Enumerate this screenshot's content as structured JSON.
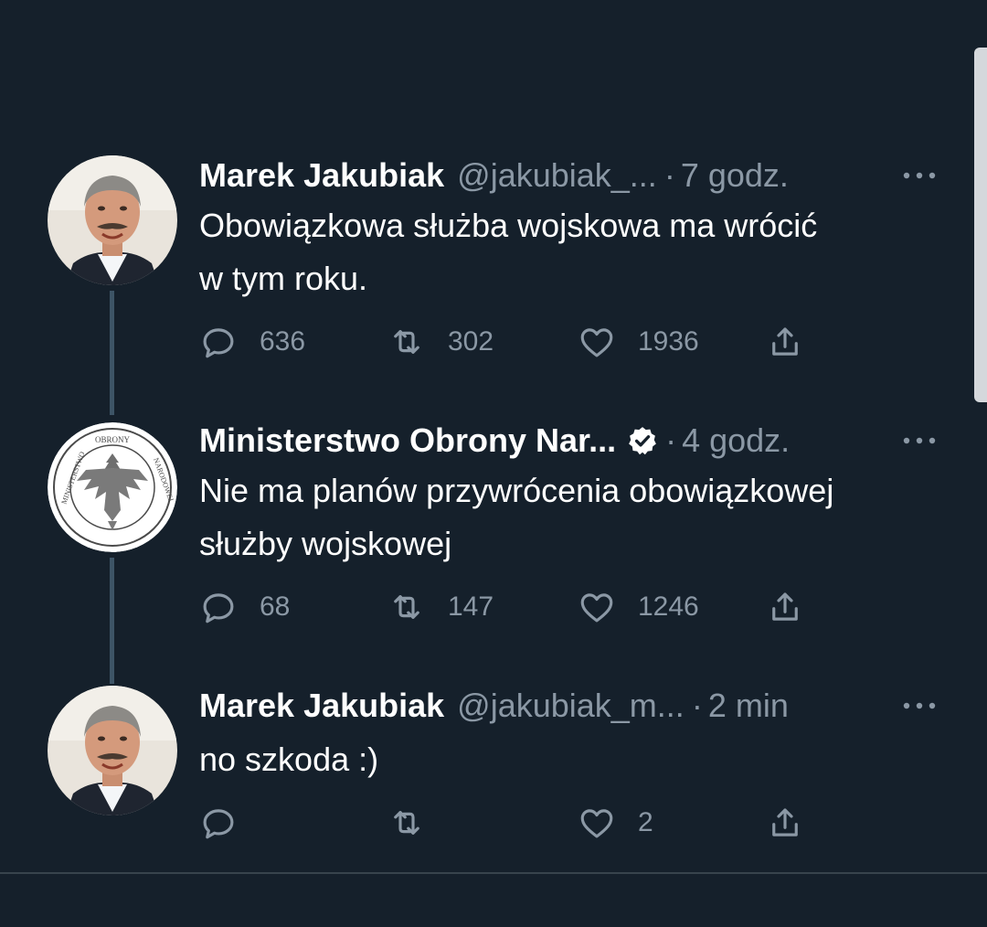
{
  "tweets": [
    {
      "name": "Marek Jakubiak",
      "handle": "@jakubiak_...",
      "separator": "·",
      "time": "7 godz.",
      "verified": false,
      "text_lines": [
        "Obowiązkowa służba wojskowa ma wrócić",
        "w tym roku."
      ],
      "replies": "636",
      "retweets": "302",
      "likes": "1936"
    },
    {
      "name": "Ministerstwo Obrony Nar...",
      "handle": "",
      "separator": "·",
      "time": "4 godz.",
      "verified": true,
      "avatar_lettering": [
        "OBRONY",
        "MINISTERSTWO",
        "NARODOWEJ"
      ],
      "text_lines": [
        "Nie ma planów przywrócenia obowiązkowej",
        "służby wojskowej"
      ],
      "replies": "68",
      "retweets": "147",
      "likes": "1246"
    },
    {
      "name": "Marek Jakubiak",
      "handle": "@jakubiak_m...",
      "separator": "·",
      "time": "2 min",
      "verified": false,
      "text_lines": [
        "no szkoda :)"
      ],
      "replies": "",
      "retweets": "",
      "likes": "2"
    }
  ],
  "icons": {
    "reply": "reply-icon",
    "retweet": "retweet-icon",
    "like": "heart-icon",
    "share": "share-icon",
    "more": "more-icon",
    "verified": "verified-badge-icon"
  },
  "colors": {
    "background": "#15202b",
    "secondary_text": "#8b98a5",
    "thread_line": "#3d5466"
  }
}
